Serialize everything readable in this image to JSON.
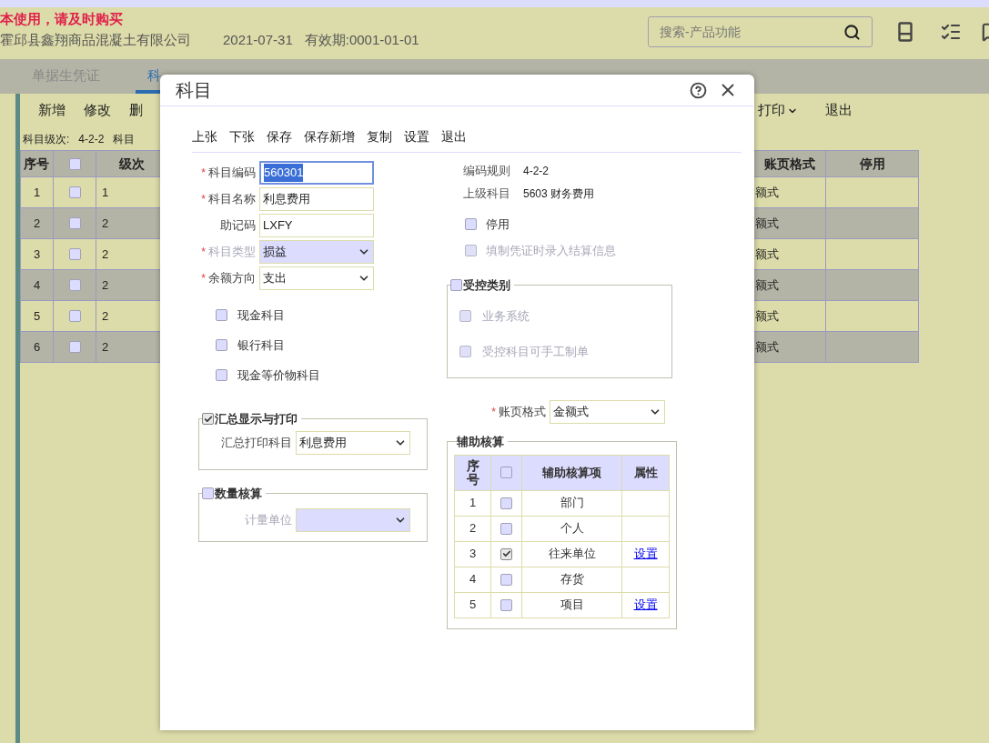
{
  "notice": "本使用，请及时购买",
  "header": {
    "company": "霍邱县鑫翔商品混凝土有限公司",
    "date": "2021-07-31",
    "validity": "有效期:0001-01-01"
  },
  "search": {
    "placeholder": "搜索-产品功能"
  },
  "tabs": [
    {
      "label": "单据生凭证",
      "selected": false
    },
    {
      "label": "科",
      "selected": true
    }
  ],
  "toolbar": {
    "left": [
      "新增",
      "修改",
      "删"
    ],
    "right": [
      {
        "label": "打印",
        "dropdown": true
      },
      {
        "label": "退出",
        "dropdown": false
      }
    ]
  },
  "level_info": [
    "科目级次:",
    "4-2-2",
    "科目"
  ],
  "table": {
    "header_checked": false,
    "columns": [
      "序号",
      "级次",
      "账页格式",
      "停用"
    ],
    "rows": [
      {
        "no": "1",
        "checked": false,
        "grade": "1",
        "ledger_format": "额式"
      },
      {
        "no": "2",
        "checked": false,
        "grade": "2",
        "ledger_format": "额式"
      },
      {
        "no": "3",
        "checked": false,
        "grade": "2",
        "ledger_format": "额式"
      },
      {
        "no": "4",
        "checked": false,
        "grade": "2",
        "ledger_format": "额式"
      },
      {
        "no": "5",
        "checked": false,
        "grade": "2",
        "ledger_format": "额式"
      },
      {
        "no": "6",
        "checked": false,
        "grade": "2",
        "ledger_format": "额式"
      }
    ]
  },
  "dialog": {
    "title": "科目",
    "toolbar": [
      "上张",
      "下张",
      "保存",
      "保存新增",
      "复制",
      "设置",
      "退出"
    ],
    "fields": [
      {
        "marker": "*",
        "label": "科目编码",
        "kind": "input",
        "value": "560301",
        "focused": true
      },
      {
        "marker": "*",
        "label": "科目名称",
        "kind": "input",
        "value": "利息费用",
        "focused": false
      },
      {
        "label": "助记码",
        "kind": "input",
        "value": "LXFY",
        "focused": false
      },
      {
        "marker": "*",
        "label": "科目类型",
        "kind": "select",
        "value": "损益",
        "disabled": true
      },
      {
        "marker": "*",
        "label": "余额方向",
        "kind": "select",
        "value": "支出",
        "disabled": false
      }
    ],
    "type_checks": [
      {
        "label": "现金科目",
        "checked": false
      },
      {
        "label": "银行科目",
        "checked": false
      },
      {
        "label": "现金等价物科目",
        "checked": false
      }
    ],
    "summary_group": {
      "legend": "汇总显示与打印",
      "checked": true,
      "field": {
        "label": "汇总打印科目",
        "value": "利息费用",
        "disabled": false
      }
    },
    "quantity_group": {
      "legend": "数量核算",
      "checked": false,
      "field": {
        "label": "计量单位",
        "disabled": true
      }
    },
    "info": [
      {
        "label": "编码规则",
        "value": "4-2-2"
      },
      {
        "label": "上级科目",
        "value": "5603 财务费用"
      }
    ],
    "options": [
      {
        "label": "停用",
        "checked": false,
        "disabled": false
      },
      {
        "label": "填制凭证时录入结算信息",
        "checked": false,
        "disabled": true
      }
    ],
    "controlled_group": {
      "legend": "受控类别",
      "checked": false,
      "items": [
        {
          "label": "业务系统",
          "checked": false,
          "disabled": true
        },
        {
          "label": "受控科目可手工制单",
          "checked": false,
          "disabled": true
        }
      ]
    },
    "ledger_format": {
      "marker": "*",
      "label": "账页格式",
      "value": "金额式"
    },
    "aux_group": {
      "legend": "辅助核算",
      "header_checked": false,
      "columns": [
        "序号",
        "辅助核算项",
        "属性"
      ],
      "rows": [
        {
          "no": "1",
          "checked": false,
          "item": "部门"
        },
        {
          "no": "2",
          "checked": false,
          "item": "个人"
        },
        {
          "no": "3",
          "checked": true,
          "item": "往来单位",
          "link": "设置"
        },
        {
          "no": "4",
          "checked": false,
          "item": "存货"
        },
        {
          "no": "5",
          "checked": false,
          "item": "项目",
          "link": "设置"
        }
      ]
    }
  }
}
